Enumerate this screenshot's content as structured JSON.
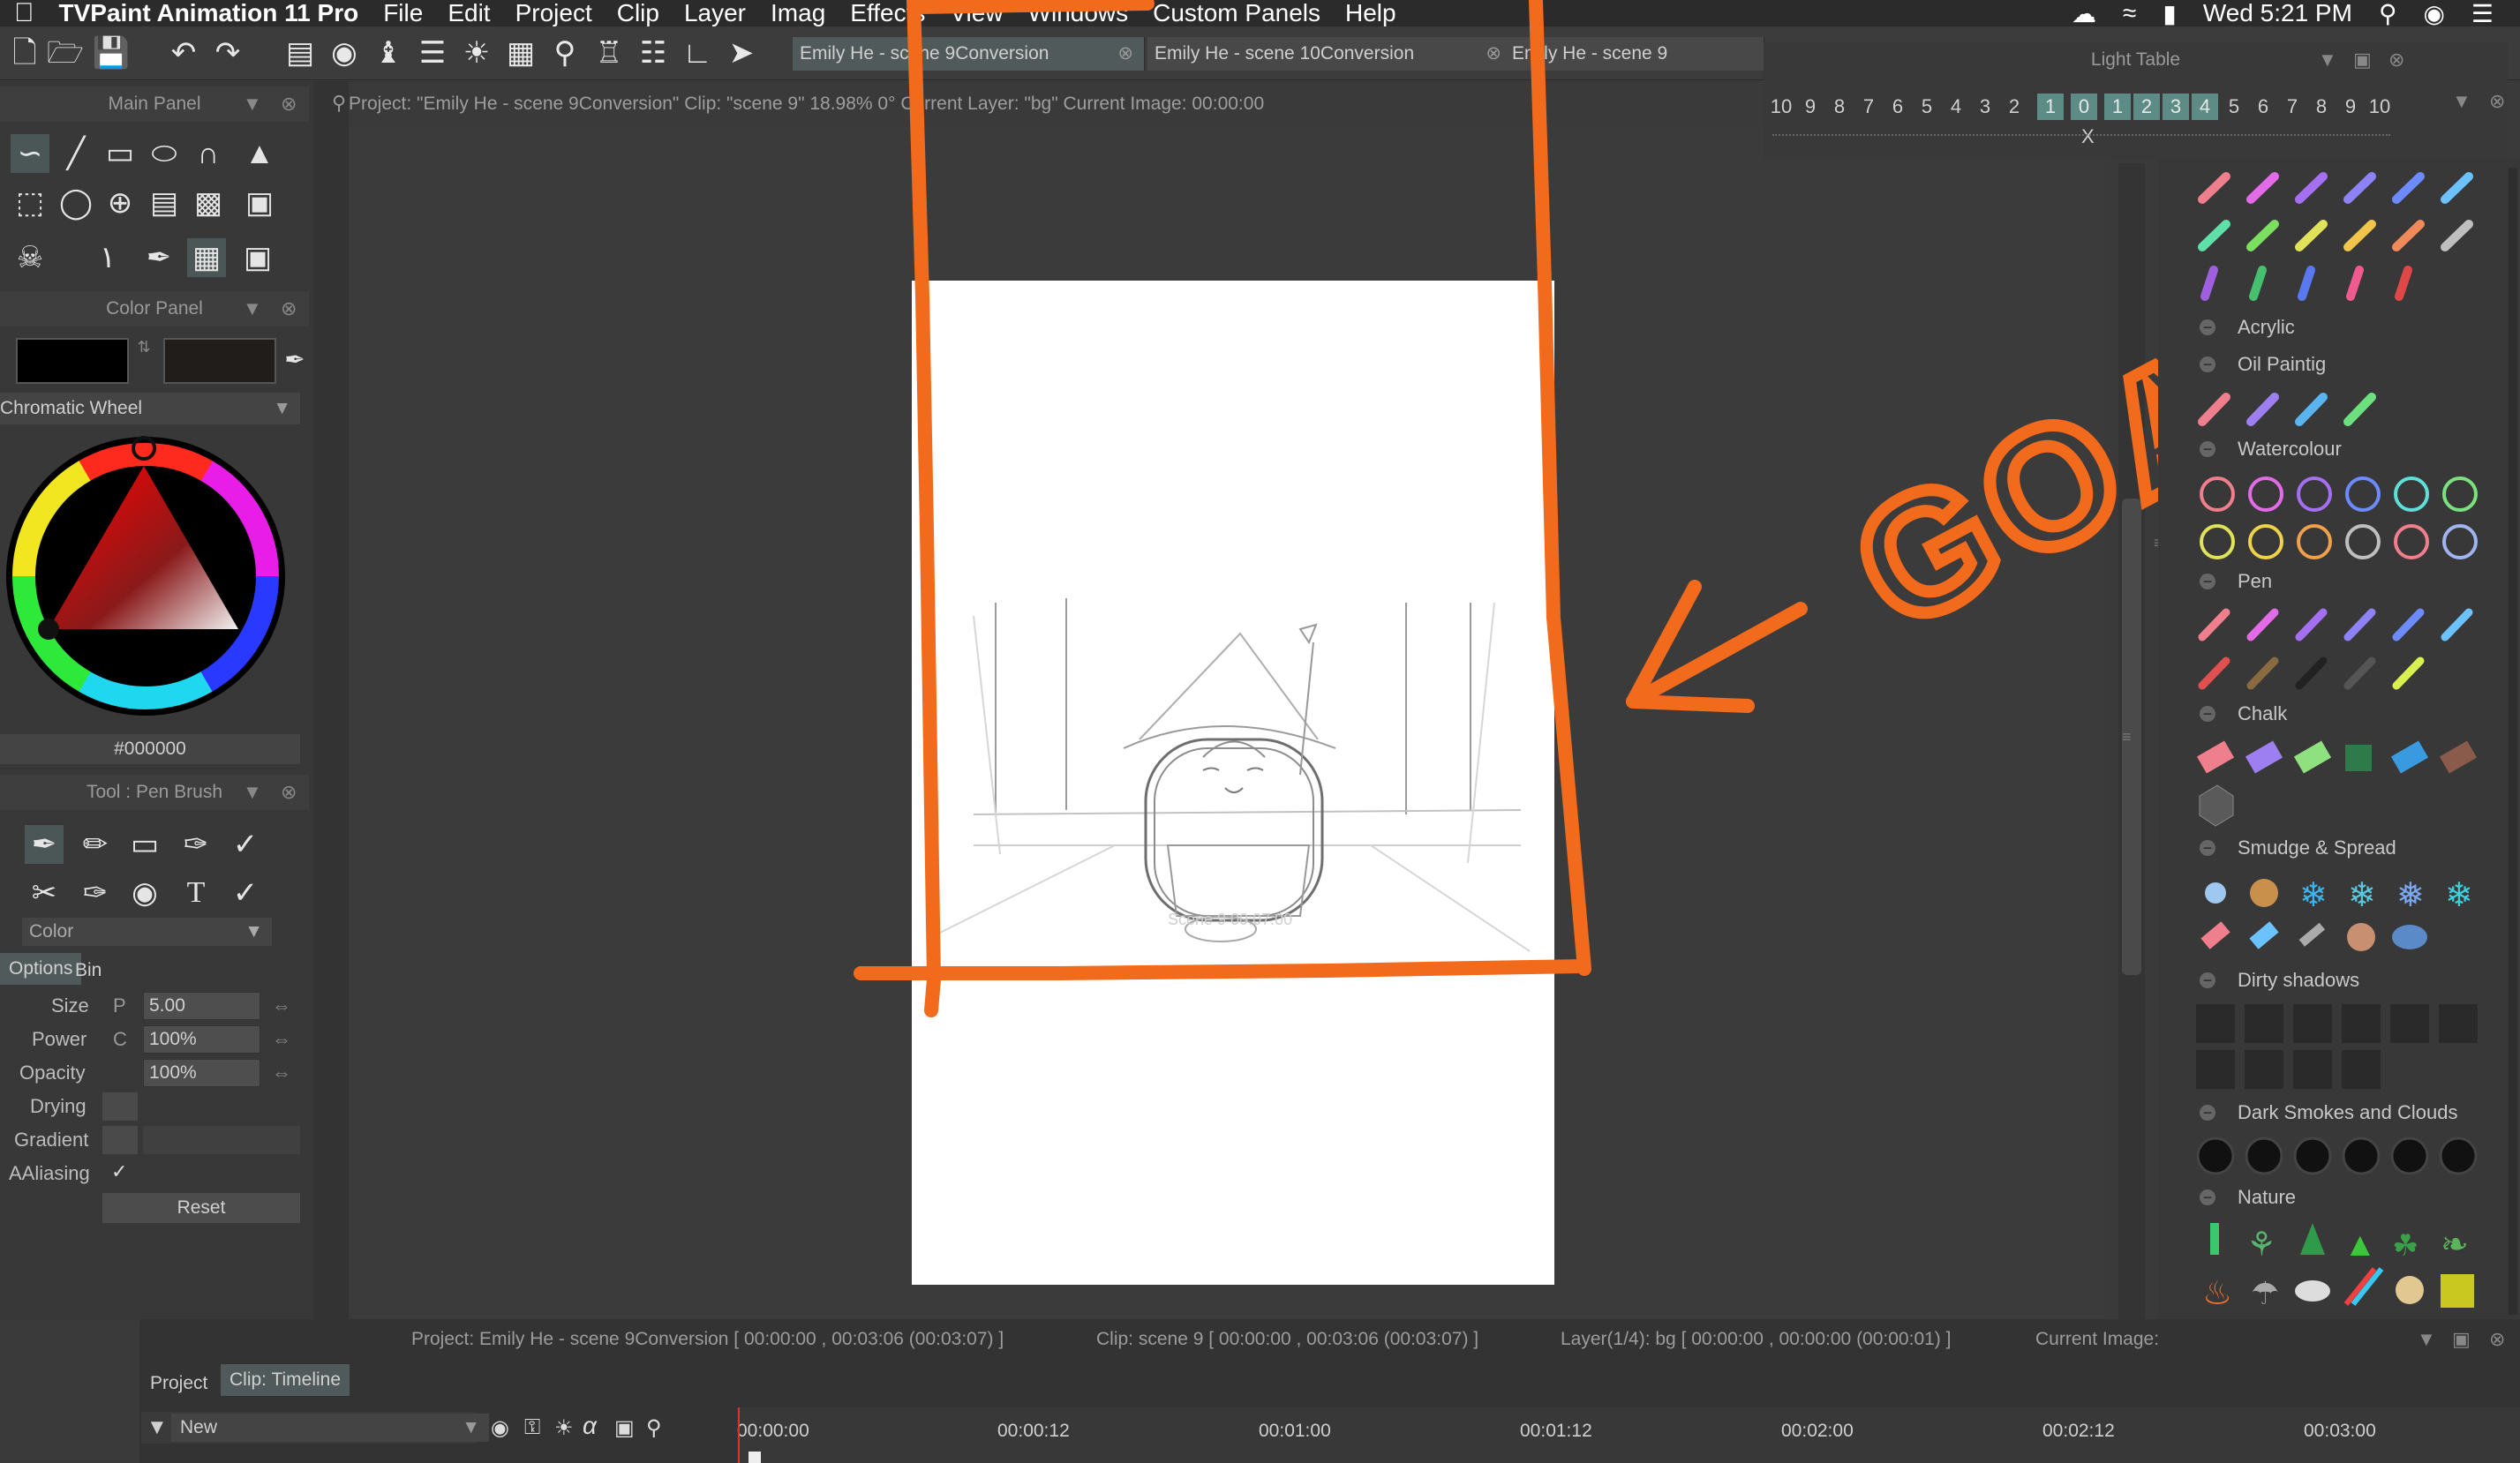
{
  "menubar": {
    "app_name": "TVPaint Animation 11 Pro",
    "items": [
      "File",
      "Edit",
      "Project",
      "Clip",
      "Layer",
      "Imag",
      "Effects",
      "View",
      "Windows",
      "Custom Panels",
      "Help"
    ],
    "datetime": "Wed 5:21 PM"
  },
  "doc_tabs": [
    {
      "label": "Emily He - scene 9Conversion"
    },
    {
      "label": "Emily He - scene 10Conversion"
    },
    {
      "label": "Emily He - scene 9"
    }
  ],
  "info_bar": "Project: \"Emily He - scene 9Conversion\"  Clip: \"scene 9\"  18.98%  0°  Current Layer: \"bg\"  Current Image: 00:00:00",
  "main_panel": {
    "title": "Main Panel"
  },
  "color_panel": {
    "title": "Color Panel",
    "mode": "Chromatic Wheel",
    "hex": "#000000",
    "primary_color": "#000000",
    "secondary_color": "#201d1b"
  },
  "tool_panel": {
    "title": "Tool : Pen Brush",
    "dropdown": "Color",
    "tabs": [
      "Options",
      "Bin"
    ],
    "params": [
      {
        "label": "Size",
        "mode": "P",
        "value": "5.00"
      },
      {
        "label": "Power",
        "mode": "C",
        "value": "100%"
      },
      {
        "label": "Opacity",
        "mode": "",
        "value": "100%"
      }
    ],
    "drying_label": "Drying",
    "gradient_label": "Gradient",
    "aaliasing_label": "AAliasing",
    "reset_label": "Reset"
  },
  "light_table": {
    "title": "Light Table",
    "numbers": [
      "10",
      "9",
      "8",
      "7",
      "6",
      "5",
      "4",
      "3",
      "2",
      "1",
      "0",
      "1",
      "2",
      "3",
      "4",
      "5",
      "6",
      "7",
      "8",
      "9",
      "10"
    ],
    "current_marker": "X"
  },
  "brush_categories": [
    "Acrylic",
    "Oil Paintig",
    "Watercolour",
    "Pen",
    "Chalk",
    "Smudge & Spread",
    "Dirty shadows",
    "Dark Smokes and Clouds",
    "Nature"
  ],
  "annotation": {
    "text": "GOAL",
    "color": "#f26a1b"
  },
  "canvas_watermark": "Scene 9 00:07:00",
  "timeline": {
    "project_info": "Project: Emily He - scene 9Conversion [ 00:00:00 , 00:03:06  (00:03:07) ]",
    "clip_info": "Clip: scene 9 [ 00:00:00 , 00:03:06  (00:03:07) ]",
    "layer_info": "Layer(1/4): bg [ 00:00:00 , 00:00:00  (00:00:01) ]",
    "current_image_label": "Current Image:",
    "tabs": [
      "Project",
      "Clip: Timeline"
    ],
    "new_label": "New",
    "ruler": [
      "00:00:00",
      "00:00:12",
      "00:01:00",
      "00:01:12",
      "00:02:00",
      "00:02:12",
      "00:03:00"
    ]
  }
}
